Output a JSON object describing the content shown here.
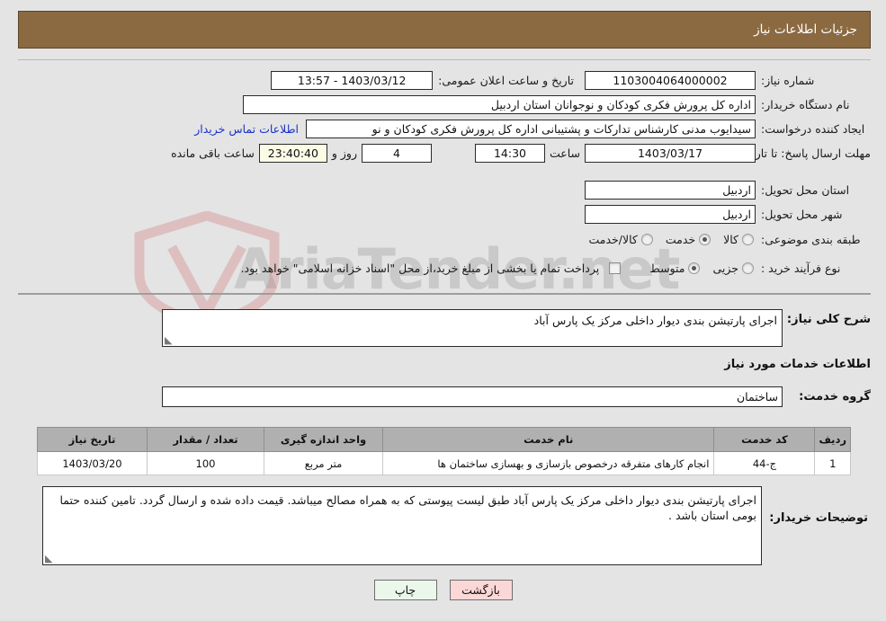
{
  "header": {
    "title": "جزئیات اطلاعات نیاز"
  },
  "form": {
    "need_number_label": "شماره نیاز:",
    "need_number_value": "1103004064000002",
    "announce_label": "تاریخ و ساعت اعلان عمومی:",
    "announce_value": "1403/03/12 - 13:57",
    "buyer_org_label": "نام دستگاه خریدار:",
    "buyer_org_value": "اداره کل پرورش فکری کودکان و نوجوانان استان اردبیل",
    "requester_label": "ایجاد کننده درخواست:",
    "requester_value": "سیدایوب مدنی کارشناس تدارکات و پشتیبانی اداره کل پرورش فکری کودکان و نو",
    "contact_link": "اطلاعات تماس خریدار",
    "deadline_label": "مهلت ارسال پاسخ: تا تاریخ:",
    "deadline_date": "1403/03/17",
    "hour_label": "ساعت",
    "deadline_time": "14:30",
    "days_remaining": "4",
    "days_label": "روز و",
    "countdown": "23:40:40",
    "countdown_label": "ساعت باقی مانده",
    "province_label": "استان محل تحویل:",
    "province_value": "اردبیل",
    "city_label": "شهر محل تحویل:",
    "city_value": "اردبیل",
    "category_label": "طبقه بندی موضوعی:",
    "category_options": [
      {
        "label": "کالا",
        "selected": false
      },
      {
        "label": "خدمت",
        "selected": true
      },
      {
        "label": "کالا/خدمت",
        "selected": false
      }
    ],
    "process_label": "نوع فرآیند خرید :",
    "process_options": [
      {
        "label": "جزیی",
        "selected": false
      },
      {
        "label": "متوسط",
        "selected": true
      }
    ],
    "treasury_checkbox_label": "پرداخت تمام یا بخشی از مبلغ خرید،از محل \"اسناد خزانه اسلامی\" خواهد بود.",
    "treasury_checked": false
  },
  "middle": {
    "general_desc_label": "شرح کلی نیاز:",
    "general_desc_value": "اجرای پارتیشن بندی دیوار داخلی مرکز یک پارس آباد",
    "services_info_title": "اطلاعات خدمات مورد نیاز",
    "service_group_label": "گروه خدمت:",
    "service_group_value": "ساختمان"
  },
  "table": {
    "headers": [
      "ردیف",
      "کد خدمت",
      "نام خدمت",
      "واحد اندازه گیری",
      "تعداد / مقدار",
      "تاریخ نیاز"
    ],
    "rows": [
      {
        "row": "1",
        "code": "ج-44",
        "name": "انجام کارهای متفرقه درخصوص بازسازی و بهسازی ساختمان ها",
        "unit": "متر مربع",
        "qty": "100",
        "date": "1403/03/20"
      }
    ]
  },
  "buyer_notes": {
    "label": "توضیحات خریدار:",
    "value": "اجرای پارتیشن بندی دیوار داخلی مرکز یک پارس آباد طبق لیست پیوستی که به همراه مصالح میباشد. قیمت داده شده و ارسال گردد. تامین کننده حتما بومی استان باشد ."
  },
  "footer": {
    "print_label": "چاپ",
    "back_label": "بازگشت"
  },
  "watermark": {
    "text": "AriaTender.net"
  },
  "colors": {
    "header_bar": "#8b6a42",
    "page_bg": "#e4e4e4",
    "link": "#1b31c8",
    "table_header": "#b0b0b0",
    "btn_back": "#fbd7d7",
    "btn_print": "#eaf7ea"
  }
}
